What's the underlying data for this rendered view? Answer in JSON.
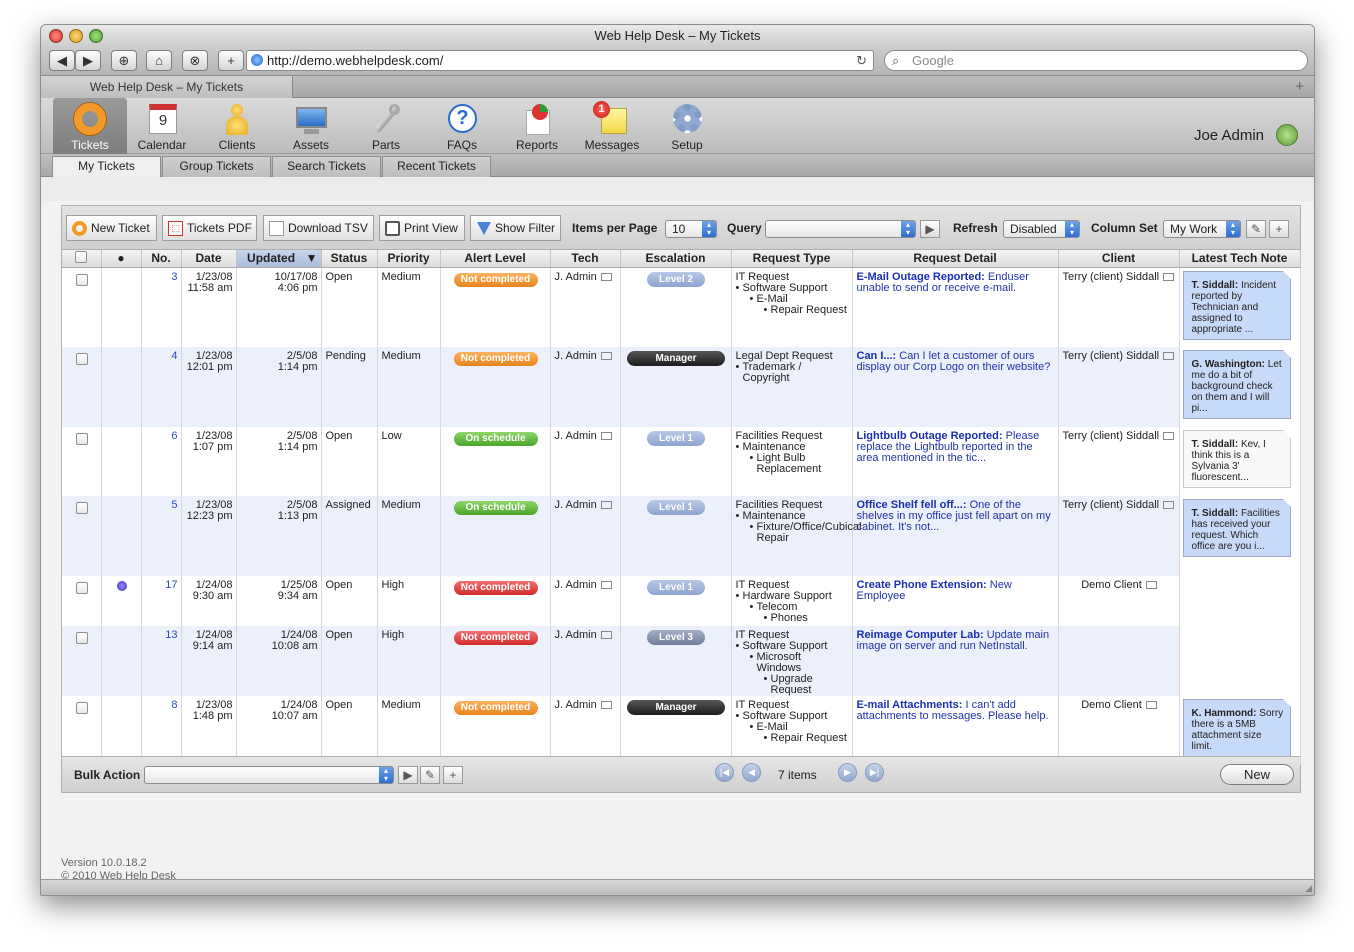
{
  "window": {
    "title": "Web Help Desk – My Tickets"
  },
  "browser": {
    "url": "http://demo.webhelpdesk.com/",
    "search_placeholder": "Google",
    "tab_title": "Web Help Desk – My Tickets"
  },
  "nav": {
    "items": [
      {
        "label": "Tickets",
        "icon": "lifebuoy-icon"
      },
      {
        "label": "Calendar",
        "icon": "calendar-icon",
        "badge": "9"
      },
      {
        "label": "Clients",
        "icon": "client-person-icon"
      },
      {
        "label": "Assets",
        "icon": "monitor-icon"
      },
      {
        "label": "Parts",
        "icon": "wrench-icon"
      },
      {
        "label": "FAQs",
        "icon": "question-icon"
      },
      {
        "label": "Reports",
        "icon": "report-chart-icon"
      },
      {
        "label": "Messages",
        "icon": "messages-notepad-icon",
        "badge": "1"
      },
      {
        "label": "Setup",
        "icon": "gear-icon"
      }
    ],
    "user": "Joe Admin"
  },
  "subtabs": [
    "My Tickets",
    "Group Tickets",
    "Search Tickets",
    "Recent Tickets"
  ],
  "toolbar": {
    "new_ticket": "New Ticket",
    "tickets_pdf": "Tickets PDF",
    "download_tsv": "Download TSV",
    "print_view": "Print View",
    "show_filter": "Show Filter",
    "items_per_page_label": "Items per Page",
    "items_per_page": "10",
    "query_label": "Query",
    "query_value": "",
    "refresh_label": "Refresh",
    "refresh_value": "Disabled",
    "column_set_label": "Column Set",
    "column_set_value": "My Work"
  },
  "columns": [
    "No.",
    "Date",
    "Updated",
    "Status",
    "Priority",
    "Alert Level",
    "Tech",
    "Escalation",
    "Request Type",
    "Request Detail",
    "Client",
    "Latest Tech Note"
  ],
  "rows": [
    {
      "no": "3",
      "date1": "1/23/08",
      "date2": "11:58 am",
      "upd1": "10/17/08",
      "upd2": "4:06 pm",
      "status": "Open",
      "priority": "Medium",
      "alert": "Not completed",
      "tech": "J. Admin",
      "esc": "Level 2",
      "rt0": "IT Request",
      "rt1": "Software Support",
      "rt2": "E-Mail",
      "rt3": "Repair Request",
      "rd_title": "E-Mail Outage Reported:",
      "rd_text": " Enduser unable to send or receive e-mail.",
      "client": "Terry (client) Siddall",
      "note_author": "T. Siddall:",
      "note_text": " Incident reported by Technician and assigned to appropriate ..."
    },
    {
      "no": "4",
      "date1": "1/23/08",
      "date2": "12:01 pm",
      "upd1": "2/5/08",
      "upd2": "1:14 pm",
      "status": "Pending",
      "priority": "Medium",
      "alert": "Not completed",
      "tech": "J. Admin",
      "esc": "Manager",
      "rt0": "Legal Dept Request",
      "rt1": "Trademark / Copyright",
      "rd_title": "Can I...:",
      "rd_text": " Can I let a customer of ours display our Corp Logo on their website?",
      "client": "Terry (client) Siddall",
      "note_author": "G. Washington:",
      "note_text": " Let me do a bit of background check on them and I will pi..."
    },
    {
      "no": "6",
      "date1": "1/23/08",
      "date2": "1:07 pm",
      "upd1": "2/5/08",
      "upd2": "1:14 pm",
      "status": "Open",
      "priority": "Low",
      "alert": "On schedule",
      "tech": "J. Admin",
      "esc": "Level 1",
      "rt0": "Facilities Request",
      "rt1": "Maintenance",
      "rt2": "Light Bulb Replacement",
      "rd_title": "Lightbulb Outage Reported:",
      "rd_text": " Please replace the Lightbulb reported in the area mentioned in the tic...",
      "client": "Terry (client) Siddall",
      "note_author": "T. Siddall:",
      "note_text": " Kev, I think this is a Sylvania 3' fluorescent..."
    },
    {
      "no": "5",
      "date1": "1/23/08",
      "date2": "12:23 pm",
      "upd1": "2/5/08",
      "upd2": "1:13 pm",
      "status": "Assigned",
      "priority": "Medium",
      "alert": "On schedule",
      "tech": "J. Admin",
      "esc": "Level 1",
      "rt0": "Facilities Request",
      "rt1": "Maintenance",
      "rt2": "Fixture/Office/Cubical Repair",
      "rd_title": "Office Shelf fell off...:",
      "rd_text": " One of the shelves in my office just fell apart on my cabinet. It's not...",
      "client": "Terry (client) Siddall",
      "note_author": "T. Siddall:",
      "note_text": " Facilities has received your request. Which office are you i..."
    },
    {
      "no": "17",
      "date1": "1/24/08",
      "date2": "9:30 am",
      "upd1": "1/25/08",
      "upd2": "9:34 am",
      "status": "Open",
      "priority": "High",
      "alert": "Not completed",
      "tech": "J. Admin",
      "esc": "Level 1",
      "rt0": "IT Request",
      "rt1": "Hardware Support",
      "rt2": "Telecom",
      "rt3": "Phones",
      "rd_title": "Create Phone Extension:",
      "rd_text": " New Employee",
      "client": "Demo Client",
      "note_author": "",
      "note_text": ""
    },
    {
      "no": "13",
      "date1": "1/24/08",
      "date2": "9:14 am",
      "upd1": "1/24/08",
      "upd2": "10:08 am",
      "status": "Open",
      "priority": "High",
      "alert": "Not completed",
      "tech": "J. Admin",
      "esc": "Level 3",
      "rt0": "IT Request",
      "rt1": "Software Support",
      "rt2": "Microsoft Windows",
      "rt3": "Upgrade Request",
      "rd_title": "Reimage Computer Lab:",
      "rd_text": " Update main image on server and run NetInstall.",
      "client": "",
      "note_author": "",
      "note_text": ""
    },
    {
      "no": "8",
      "date1": "1/23/08",
      "date2": "1:48 pm",
      "upd1": "1/24/08",
      "upd2": "10:07 am",
      "status": "Open",
      "priority": "Medium",
      "alert": "Not completed",
      "tech": "J. Admin",
      "esc": "Manager",
      "rt0": "IT Request",
      "rt1": "Software Support",
      "rt2": "E-Mail",
      "rt3": "Repair Request",
      "rd_title": "E-mail Attachments:",
      "rd_text": " I can't add attachments to messages. Please help.",
      "client": "Demo Client",
      "note_author": "K. Hammond:",
      "note_text": " Sorry there is a 5MB attachment size limit."
    }
  ],
  "footer": {
    "bulk_action_label": "Bulk Action",
    "items_count": "7 items",
    "new_button": "New"
  },
  "version": {
    "line1": "Version 10.0.18.2",
    "line2": "© 2010 Web Help Desk"
  },
  "colors": {
    "accent": "#2d6cd4",
    "link": "#1b2fb0",
    "note_blue": "#c8dafa",
    "row_alt": "#ebf0fa"
  }
}
